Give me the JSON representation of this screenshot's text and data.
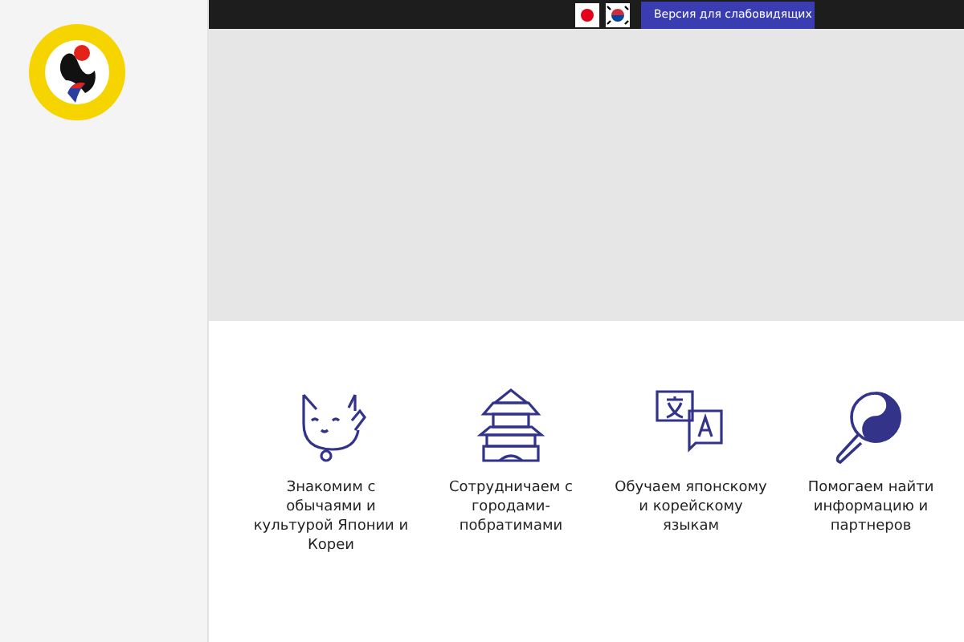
{
  "top_bar": {
    "languages": [
      {
        "kind": "japan"
      },
      {
        "kind": "korea"
      }
    ],
    "accessibility_button": "Версия для слабовидящих"
  },
  "features": [
    {
      "kind": "cat",
      "text": "Знакомим с обычаями и культурой Японии и Кореи"
    },
    {
      "kind": "castle",
      "text": "Сотрудничаем с городами-побратимами"
    },
    {
      "kind": "translate",
      "text": "Обучаем японскому и корейскому языкам"
    },
    {
      "kind": "search",
      "text": "Помогаем найти информацию и партнеров"
    }
  ]
}
